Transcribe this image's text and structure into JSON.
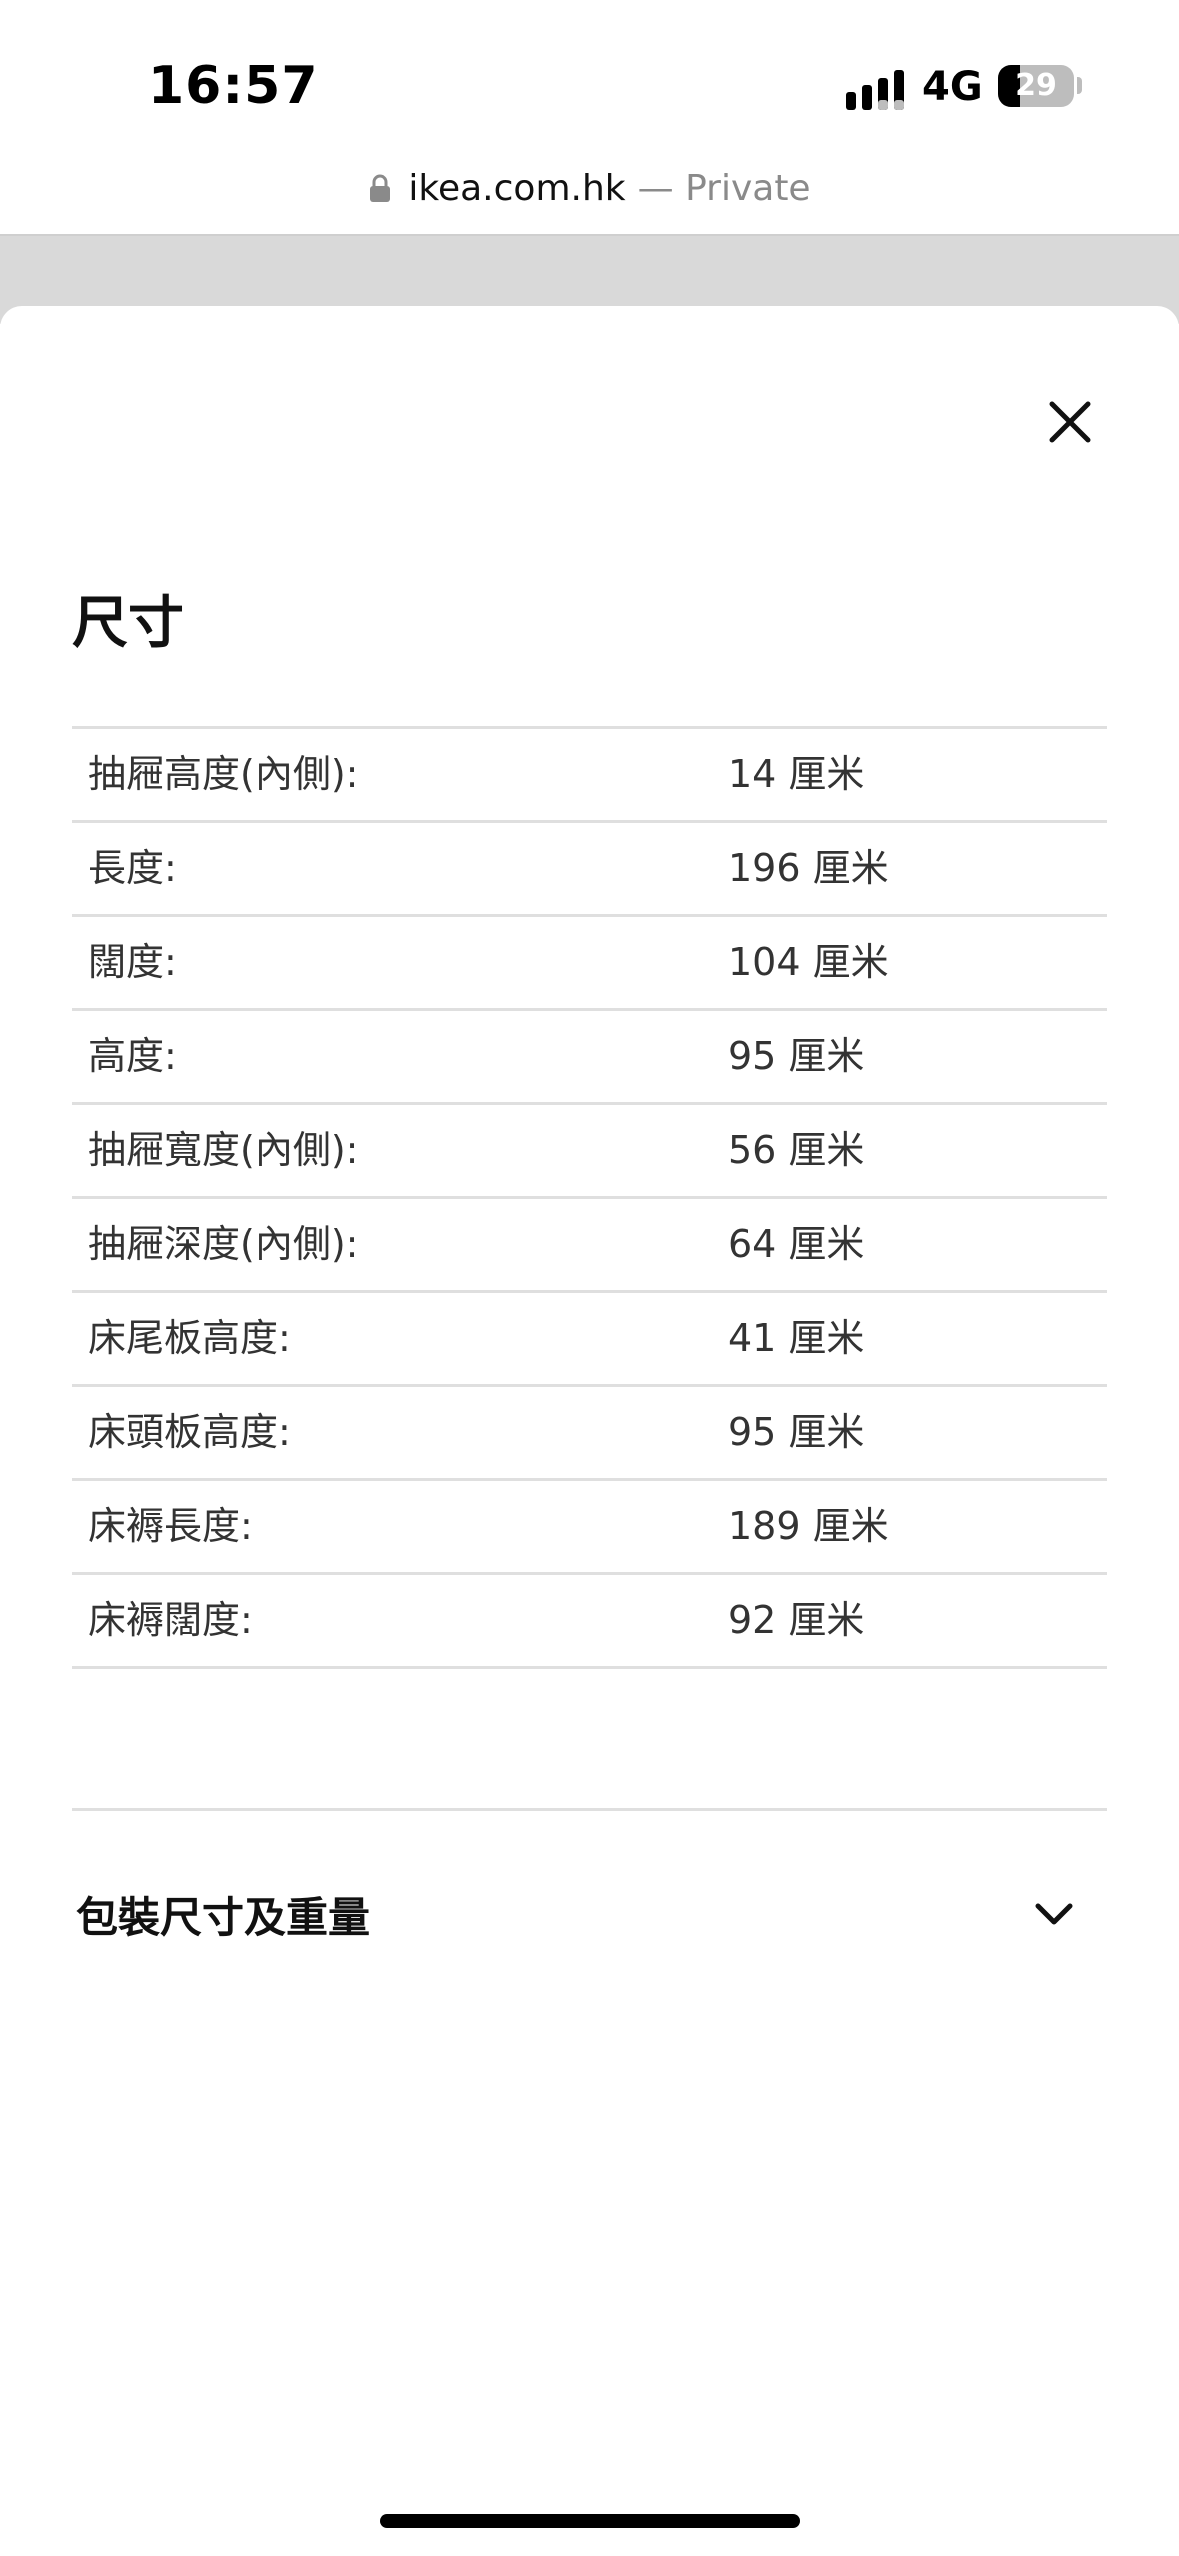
{
  "status_bar": {
    "time": "16:57",
    "network": "4G",
    "battery_level": "29",
    "icons": [
      "signal-icon",
      "battery-icon"
    ]
  },
  "address_bar": {
    "domain": "ikea.com.hk",
    "private_label": "— Private",
    "icon": "lock-icon"
  },
  "sheet": {
    "close_icon": "close-icon",
    "title": "尺寸",
    "rows": [
      {
        "label": "抽屜高度(內側):",
        "value": "14 厘米"
      },
      {
        "label": "長度:",
        "value": "196 厘米"
      },
      {
        "label": "闊度:",
        "value": "104 厘米"
      },
      {
        "label": "高度:",
        "value": "95 厘米"
      },
      {
        "label": "抽屜寬度(內側):",
        "value": "56 厘米"
      },
      {
        "label": "抽屜深度(內側):",
        "value": "64 厘米"
      },
      {
        "label": "床尾板高度:",
        "value": "41 厘米"
      },
      {
        "label": "床頭板高度:",
        "value": "95 厘米"
      },
      {
        "label": "床褥長度:",
        "value": "189 厘米"
      },
      {
        "label": "床褥闊度:",
        "value": "92 厘米"
      }
    ],
    "package_section": {
      "title": "包裝尺寸及重量",
      "icon": "chevron-down-icon"
    }
  },
  "colors": {
    "text": "#111111",
    "secondary_text": "#333333",
    "divider": "#dfdfdf",
    "dim_overlay": "#d9d9d9"
  }
}
